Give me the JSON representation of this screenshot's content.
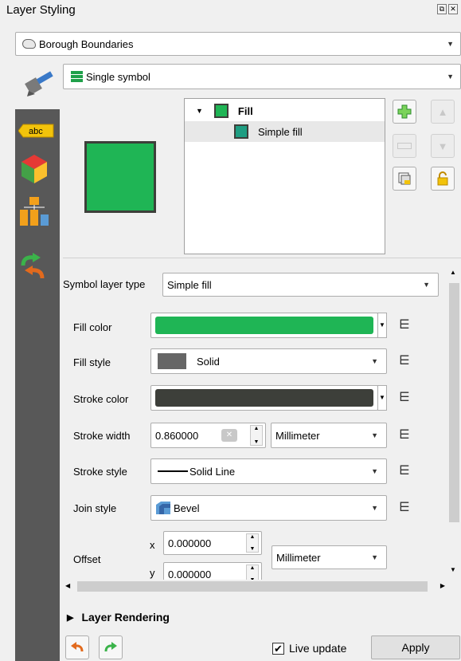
{
  "window": {
    "title": "Layer Styling"
  },
  "layer": {
    "name": "Borough Boundaries"
  },
  "renderer": {
    "type": "Single symbol"
  },
  "tree": {
    "items": [
      "Fill",
      "Simple fill"
    ]
  },
  "form": {
    "symbol_layer_type_label": "Symbol layer type",
    "symbol_layer_type_value": "Simple fill",
    "fill_color_label": "Fill color",
    "fill_style_label": "Fill style",
    "fill_style_value": "Solid",
    "stroke_color_label": "Stroke color",
    "stroke_width_label": "Stroke width",
    "stroke_width_value": "0.860000",
    "stroke_width_unit": "Millimeter",
    "stroke_style_label": "Stroke style",
    "stroke_style_value": "Solid Line",
    "join_style_label": "Join style",
    "join_style_value": "Bevel",
    "offset_label": "Offset",
    "offset_x_label": "x",
    "offset_x_value": "0.000000",
    "offset_y_label": "y",
    "offset_y_value": "0.000000",
    "offset_unit": "Millimeter"
  },
  "layer_rendering": {
    "label": "Layer Rendering"
  },
  "footer": {
    "live_update_label": "Live update",
    "live_update_checked": true,
    "apply_label": "Apply"
  },
  "colors": {
    "fill": "#1fb555",
    "stroke": "#3d3f3a",
    "fill_style_swatch": "#666666",
    "simple_fill_swatch": "#1f9e82",
    "sidebar": "#585858"
  },
  "icons": {
    "close": "close-icon",
    "float": "float-icon",
    "polygon": "polygon-icon",
    "single_symbol": "single-symbol-icon",
    "paintbrush": "paintbrush-icon",
    "labels": "labels-icon",
    "3d": "3d-icon",
    "diagrams": "diagrams-icon",
    "history": "history-icon"
  }
}
